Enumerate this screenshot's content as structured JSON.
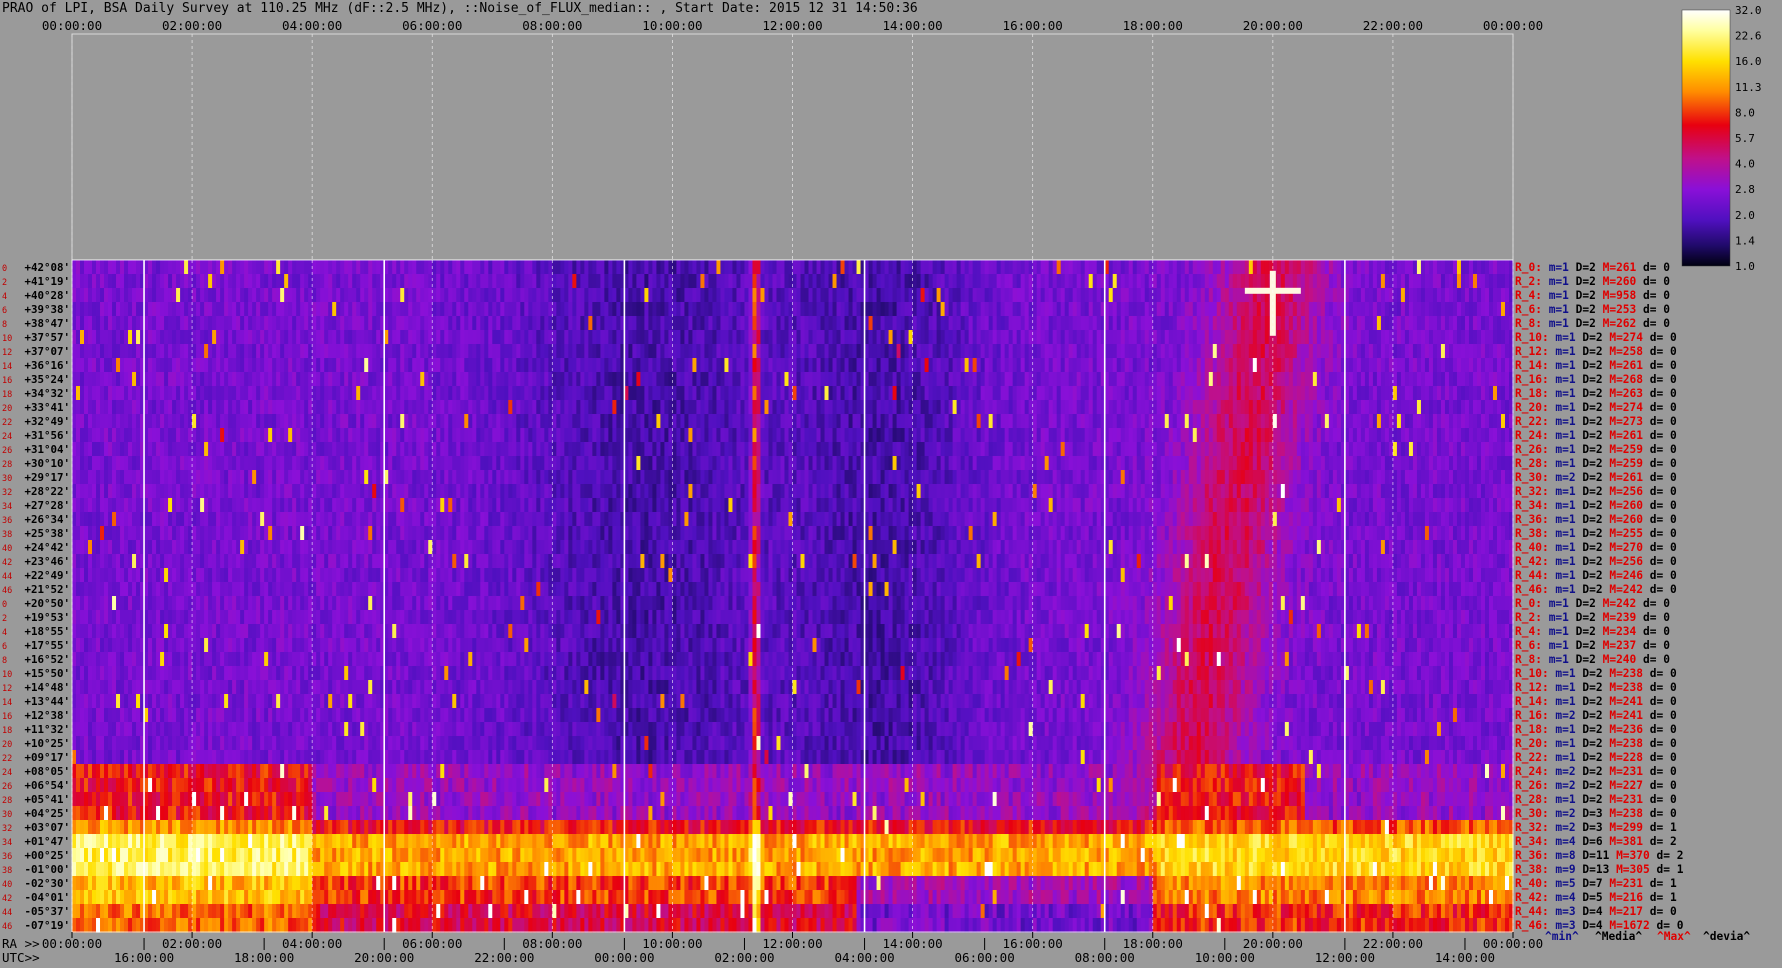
{
  "title": "PRAO of LPI, BSA Daily Survey at 110.25 MHz (dF::2.5 MHz), ::Noise_of_FLUX_median:: , Start Date: 2015 12 31 14:50:36",
  "colors": {
    "background": "#9a9a9a",
    "label_blue": "#10108a",
    "label_red": "#e00000",
    "dec_text": "#000000",
    "index_text": "#c00000"
  },
  "chart_data": {
    "type": "heatmap",
    "title": "PRAO of LPI, BSA Daily Survey at 110.25 MHz (dF::2.5 MHz), ::Noise_of_FLUX_median:: , Start Date: 2015 12 31 14:50:36",
    "top_axis_ticks": [
      "00:00:00",
      "02:00:00",
      "04:00:00",
      "06:00:00",
      "08:00:00",
      "10:00:00",
      "12:00:00",
      "14:00:00",
      "16:00:00",
      "18:00:00",
      "20:00:00",
      "22:00:00",
      "00:00:00"
    ],
    "ra_axis_label": "RA >>",
    "ra_ticks": [
      "00:00:00",
      "02:00:00",
      "04:00:00",
      "06:00:00",
      "08:00:00",
      "10:00:00",
      "12:00:00",
      "14:00:00",
      "16:00:00",
      "18:00:00",
      "20:00:00",
      "22:00:00",
      "00:00:00"
    ],
    "utc_axis_label": "UTC>>",
    "utc_ticks": [
      "16:00:00",
      "18:00:00",
      "20:00:00",
      "22:00:00",
      "00:00:00",
      "02:00:00",
      "04:00:00",
      "06:00:00",
      "08:00:00",
      "10:00:00",
      "12:00:00",
      "14:00:00"
    ],
    "colorbar": {
      "ticks": [
        "32.0",
        "22.6",
        "16.0",
        "11.3",
        "8.0",
        "5.7",
        "4.0",
        "2.8",
        "2.0",
        "1.4",
        "1.0"
      ],
      "scale": "log",
      "range": [
        1.0,
        32.0
      ]
    },
    "grid": true,
    "footer_legend": [
      {
        "text": "^min^",
        "color": "#10108a"
      },
      {
        "text": "^Media^",
        "color": "#000000"
      },
      {
        "text": "^Max^",
        "color": "#e00000"
      },
      {
        "text": "^devia^",
        "color": "#000000"
      }
    ],
    "rows": [
      {
        "idx": "0",
        "dec": "+42°08'",
        "beam": "R_0:",
        "m": "1",
        "D": "2",
        "M": "261",
        "d": "0"
      },
      {
        "idx": "2",
        "dec": "+41°19'",
        "beam": "R_2:",
        "m": "1",
        "D": "2",
        "M": "260",
        "d": "0"
      },
      {
        "idx": "4",
        "dec": "+40°28'",
        "beam": "R_4:",
        "m": "1",
        "D": "2",
        "M": "958",
        "d": "0"
      },
      {
        "idx": "6",
        "dec": "+39°38'",
        "beam": "R_6:",
        "m": "1",
        "D": "2",
        "M": "253",
        "d": "0"
      },
      {
        "idx": "8",
        "dec": "+38°47'",
        "beam": "R_8:",
        "m": "1",
        "D": "2",
        "M": "262",
        "d": "0"
      },
      {
        "idx": "10",
        "dec": "+37°57'",
        "beam": "R_10:",
        "m": "1",
        "D": "2",
        "M": "274",
        "d": "0"
      },
      {
        "idx": "12",
        "dec": "+37°07'",
        "beam": "R_12:",
        "m": "1",
        "D": "2",
        "M": "258",
        "d": "0"
      },
      {
        "idx": "14",
        "dec": "+36°16'",
        "beam": "R_14:",
        "m": "1",
        "D": "2",
        "M": "261",
        "d": "0"
      },
      {
        "idx": "16",
        "dec": "+35°24'",
        "beam": "R_16:",
        "m": "1",
        "D": "2",
        "M": "268",
        "d": "0"
      },
      {
        "idx": "18",
        "dec": "+34°32'",
        "beam": "R_18:",
        "m": "1",
        "D": "2",
        "M": "263",
        "d": "0"
      },
      {
        "idx": "20",
        "dec": "+33°41'",
        "beam": "R_20:",
        "m": "1",
        "D": "2",
        "M": "274",
        "d": "0"
      },
      {
        "idx": "22",
        "dec": "+32°49'",
        "beam": "R_22:",
        "m": "1",
        "D": "2",
        "M": "273",
        "d": "0"
      },
      {
        "idx": "24",
        "dec": "+31°56'",
        "beam": "R_24:",
        "m": "1",
        "D": "2",
        "M": "261",
        "d": "0"
      },
      {
        "idx": "26",
        "dec": "+31°04'",
        "beam": "R_26:",
        "m": "1",
        "D": "2",
        "M": "259",
        "d": "0"
      },
      {
        "idx": "28",
        "dec": "+30°10'",
        "beam": "R_28:",
        "m": "1",
        "D": "2",
        "M": "259",
        "d": "0"
      },
      {
        "idx": "30",
        "dec": "+29°17'",
        "beam": "R_30:",
        "m": "2",
        "D": "2",
        "M": "261",
        "d": "0"
      },
      {
        "idx": "32",
        "dec": "+28°22'",
        "beam": "R_32:",
        "m": "1",
        "D": "2",
        "M": "256",
        "d": "0"
      },
      {
        "idx": "34",
        "dec": "+27°28'",
        "beam": "R_34:",
        "m": "1",
        "D": "2",
        "M": "260",
        "d": "0"
      },
      {
        "idx": "36",
        "dec": "+26°34'",
        "beam": "R_36:",
        "m": "1",
        "D": "2",
        "M": "260",
        "d": "0"
      },
      {
        "idx": "38",
        "dec": "+25°38'",
        "beam": "R_38:",
        "m": "1",
        "D": "2",
        "M": "255",
        "d": "0"
      },
      {
        "idx": "40",
        "dec": "+24°42'",
        "beam": "R_40:",
        "m": "1",
        "D": "2",
        "M": "270",
        "d": "0"
      },
      {
        "idx": "42",
        "dec": "+23°46'",
        "beam": "R_42:",
        "m": "1",
        "D": "2",
        "M": "256",
        "d": "0"
      },
      {
        "idx": "44",
        "dec": "+22°49'",
        "beam": "R_44:",
        "m": "1",
        "D": "2",
        "M": "246",
        "d": "0"
      },
      {
        "idx": "46",
        "dec": "+21°52'",
        "beam": "R_46:",
        "m": "1",
        "D": "2",
        "M": "242",
        "d": "0"
      },
      {
        "idx": "0",
        "dec": "+20°50'",
        "beam": "R_0:",
        "m": "1",
        "D": "2",
        "M": "242",
        "d": "0"
      },
      {
        "idx": "2",
        "dec": "+19°53'",
        "beam": "R_2:",
        "m": "1",
        "D": "2",
        "M": "239",
        "d": "0"
      },
      {
        "idx": "4",
        "dec": "+18°55'",
        "beam": "R_4:",
        "m": "1",
        "D": "2",
        "M": "234",
        "d": "0"
      },
      {
        "idx": "6",
        "dec": "+17°55'",
        "beam": "R_6:",
        "m": "1",
        "D": "2",
        "M": "237",
        "d": "0"
      },
      {
        "idx": "8",
        "dec": "+16°52'",
        "beam": "R_8:",
        "m": "1",
        "D": "2",
        "M": "240",
        "d": "0"
      },
      {
        "idx": "10",
        "dec": "+15°50'",
        "beam": "R_10:",
        "m": "1",
        "D": "2",
        "M": "238",
        "d": "0"
      },
      {
        "idx": "12",
        "dec": "+14°48'",
        "beam": "R_12:",
        "m": "1",
        "D": "2",
        "M": "238",
        "d": "0"
      },
      {
        "idx": "14",
        "dec": "+13°44'",
        "beam": "R_14:",
        "m": "1",
        "D": "2",
        "M": "241",
        "d": "0"
      },
      {
        "idx": "16",
        "dec": "+12°38'",
        "beam": "R_16:",
        "m": "2",
        "D": "2",
        "M": "241",
        "d": "0"
      },
      {
        "idx": "18",
        "dec": "+11°32'",
        "beam": "R_18:",
        "m": "1",
        "D": "2",
        "M": "236",
        "d": "0"
      },
      {
        "idx": "20",
        "dec": "+10°25'",
        "beam": "R_20:",
        "m": "1",
        "D": "2",
        "M": "238",
        "d": "0"
      },
      {
        "idx": "22",
        "dec": "+09°17'",
        "beam": "R_22:",
        "m": "1",
        "D": "2",
        "M": "228",
        "d": "0"
      },
      {
        "idx": "24",
        "dec": "+08°05'",
        "beam": "R_24:",
        "m": "2",
        "D": "2",
        "M": "231",
        "d": "0"
      },
      {
        "idx": "26",
        "dec": "+06°54'",
        "beam": "R_26:",
        "m": "2",
        "D": "2",
        "M": "227",
        "d": "0"
      },
      {
        "idx": "28",
        "dec": "+05°41'",
        "beam": "R_28:",
        "m": "1",
        "D": "2",
        "M": "231",
        "d": "0"
      },
      {
        "idx": "30",
        "dec": "+04°25'",
        "beam": "R_30:",
        "m": "2",
        "D": "3",
        "M": "238",
        "d": "0"
      },
      {
        "idx": "32",
        "dec": "+03°07'",
        "beam": "R_32:",
        "m": "2",
        "D": "3",
        "M": "299",
        "d": "1"
      },
      {
        "idx": "34",
        "dec": "+01°47'",
        "beam": "R_34:",
        "m": "4",
        "D": "6",
        "M": "381",
        "d": "2"
      },
      {
        "idx": "36",
        "dec": "+00°25'",
        "beam": "R_36:",
        "m": "8",
        "D": "11",
        "M": "370",
        "d": "2"
      },
      {
        "idx": "38",
        "dec": "-01°00'",
        "beam": "R_38:",
        "m": "9",
        "D": "13",
        "M": "305",
        "d": "1"
      },
      {
        "idx": "40",
        "dec": "-02°30'",
        "beam": "R_40:",
        "m": "5",
        "D": "7",
        "M": "231",
        "d": "1"
      },
      {
        "idx": "42",
        "dec": "-04°01'",
        "beam": "R_42:",
        "m": "4",
        "D": "5",
        "M": "216",
        "d": "1"
      },
      {
        "idx": "44",
        "dec": "-05°37'",
        "beam": "R_44:",
        "m": "3",
        "D": "4",
        "M": "217",
        "d": "0"
      },
      {
        "idx": "46",
        "dec": "-07°19'",
        "beam": "R_46:",
        "m": "3",
        "D": "4",
        "M": "1672",
        "d": "0"
      }
    ]
  }
}
